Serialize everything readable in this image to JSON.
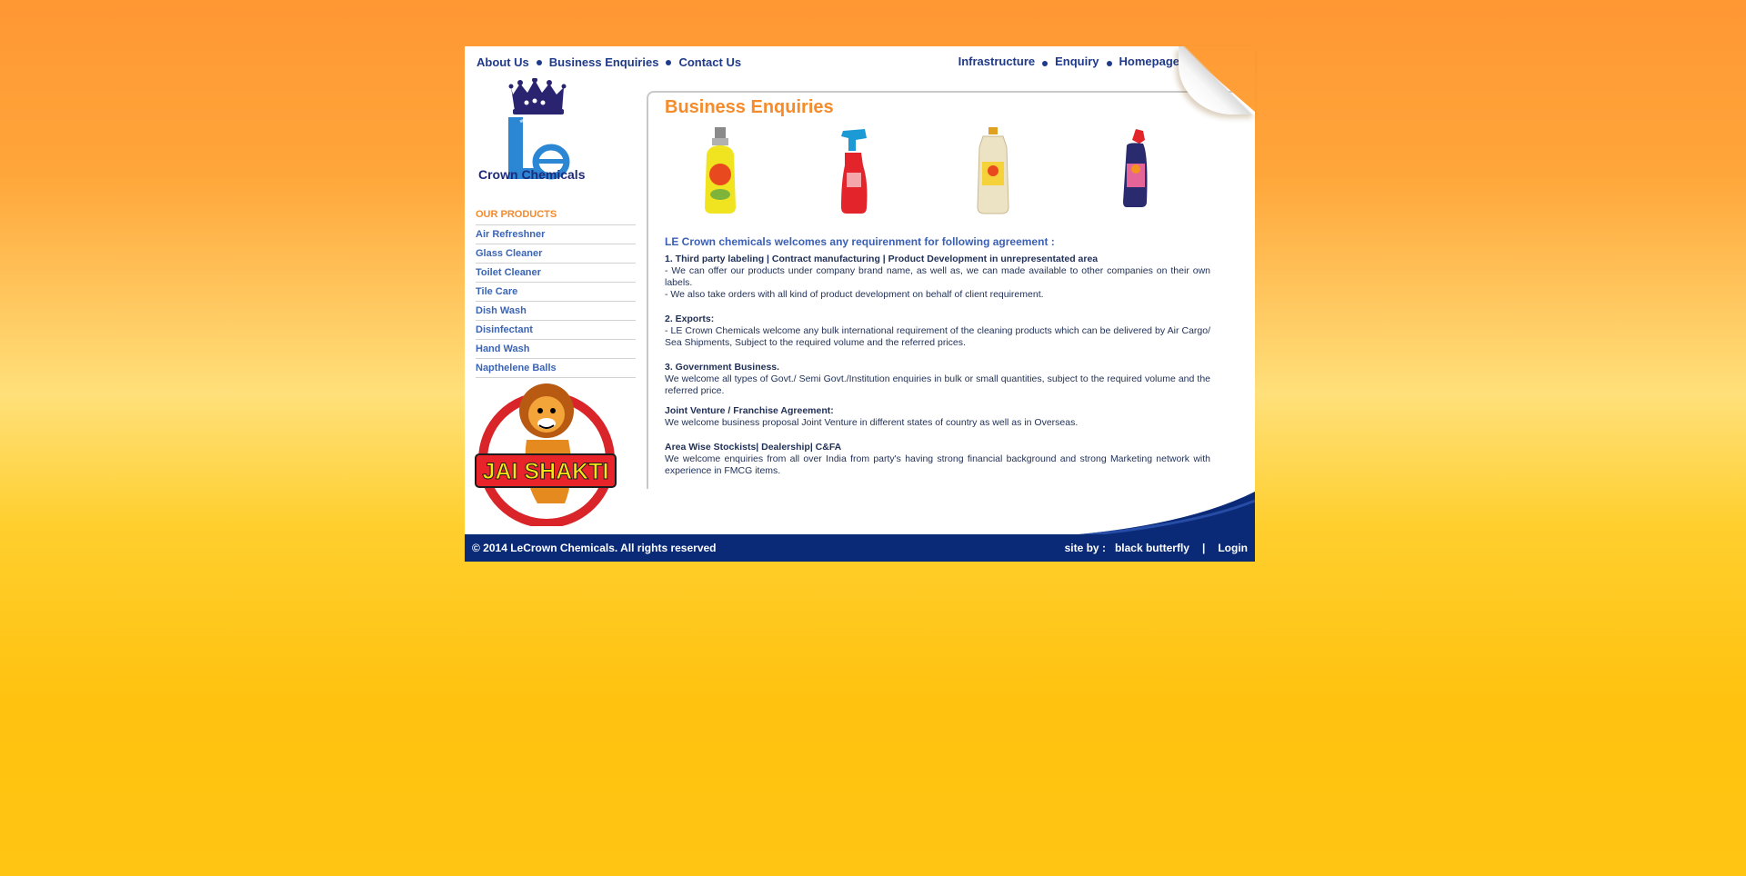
{
  "nav": {
    "left": [
      "About Us",
      "Business Enquiries",
      "Contact Us"
    ],
    "right": [
      "Infrastructure",
      "Enquiry",
      "Homepage"
    ]
  },
  "logo": {
    "name": "Crown Chemicals"
  },
  "sidebar": {
    "heading": "OUR PRODUCTS",
    "items": [
      "Air Refreshner",
      "Glass Cleaner",
      "Toilet Cleaner",
      "Tile Care",
      "Dish Wash",
      "Disinfectant",
      "Hand Wash",
      "Napthelene Balls"
    ]
  },
  "badge": {
    "text": "JAI SHAKTI"
  },
  "content": {
    "title": "Business Enquiries",
    "intro": "LE Crown chemicals welcomes any requirenment for following agreement :",
    "sections": [
      {
        "title": "1. Third party labeling | Contract manufacturing | Product Development in unrepresentated area",
        "lines": [
          "- We can offer our products under company brand name, as well as, we can made available to other companies on their own labels.",
          "- We also take orders with all kind of product development on behalf of client requirement."
        ]
      },
      {
        "title": "2. Exports:",
        "lines": [
          "- LE Crown Chemicals welcome any bulk international requirement of the cleaning products which can be delivered by Air Cargo/ Sea Shipments, Subject to the required volume and the referred prices."
        ]
      },
      {
        "title": "3. Government Business.",
        "lines": [
          "We welcome all types of Govt./ Semi Govt./Institution enquiries in bulk or small quantities, subject to the required volume and the referred price."
        ]
      },
      {
        "title": "Joint Venture / Franchise Agreement:",
        "lines": [
          "We welcome business proposal Joint Venture in different states of country as well as in Overseas."
        ]
      },
      {
        "title": "Area Wise Stockists| Dealership| C&FA",
        "lines": [
          "We welcome enquiries from all over India from party's having strong financial background and strong Marketing network with experience in FMCG items."
        ]
      }
    ]
  },
  "footer": {
    "copyright": "© 2014 LeCrown Chemicals. All rights reserved",
    "site_by_label": "site by :",
    "site_by": "black butterfly",
    "separator": "|",
    "login": "Login"
  },
  "colors": {
    "accent_orange": "#f58b2a",
    "nav_blue": "#1f3a8a",
    "footer_blue": "#0a2a78"
  }
}
